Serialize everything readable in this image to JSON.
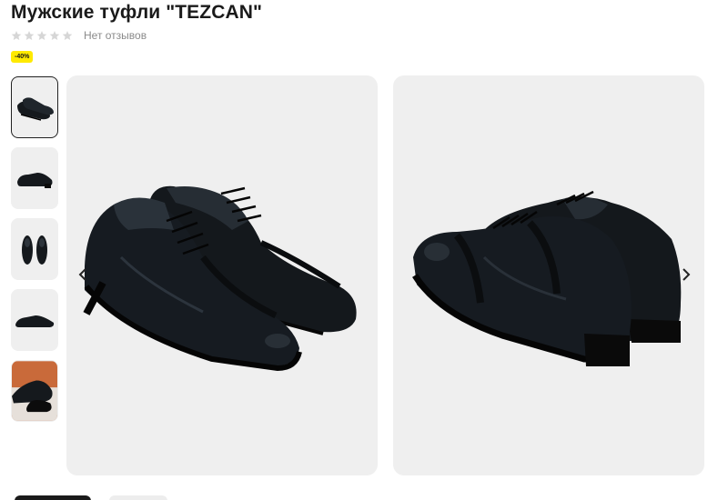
{
  "product": {
    "title": "Мужские туфли \"TEZCAN\"",
    "reviews_text": "Нет отзывов",
    "rating": 0,
    "rating_max": 5,
    "discount_badge": "-40%"
  },
  "colors": {
    "badge": "#ffea00",
    "photo_bg": "#efefef",
    "star_empty": "#d6d6d6"
  },
  "gallery": {
    "thumbnails_count": 5,
    "active_thumbnail": 1,
    "icons": {
      "prev": "chevron-left-icon",
      "next": "chevron-right-icon"
    }
  }
}
